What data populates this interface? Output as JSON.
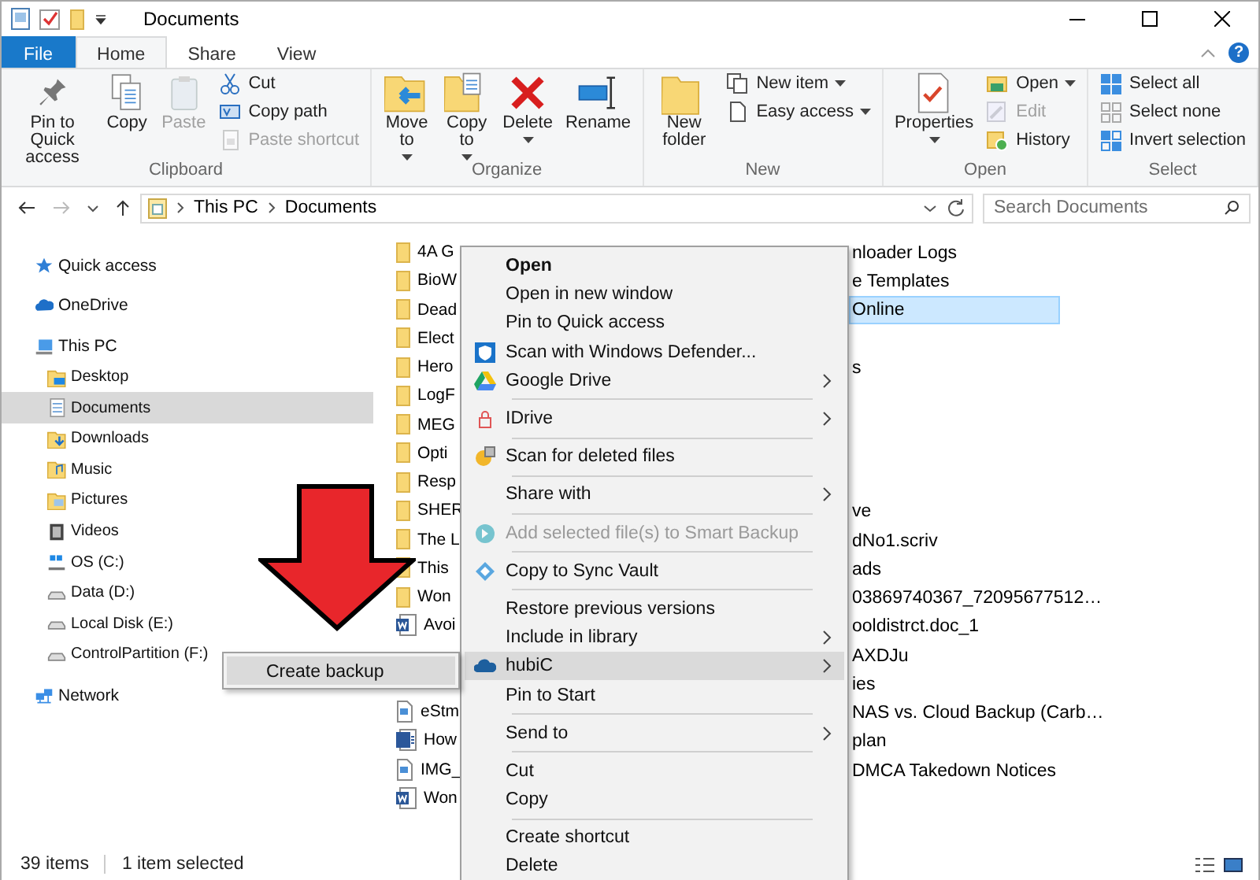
{
  "window": {
    "title": "Documents"
  },
  "ribbon_tabs": [
    {
      "label": "File",
      "kind": "file",
      "selected": false
    },
    {
      "label": "Home",
      "kind": "tab",
      "selected": true
    },
    {
      "label": "Share",
      "kind": "tab",
      "selected": false
    },
    {
      "label": "View",
      "kind": "tab",
      "selected": false
    }
  ],
  "help": {
    "label": "?"
  },
  "ribbon": {
    "groups": [
      {
        "label": "Clipboard",
        "buttons": [
          {
            "label": "Pin to Quick access",
            "kind": "large",
            "disabled": false,
            "dropdown": false
          },
          {
            "label": "Copy",
            "kind": "large",
            "disabled": false,
            "dropdown": false
          },
          {
            "label": "Paste",
            "kind": "large",
            "disabled": true,
            "dropdown": false
          },
          {
            "label": "Cut",
            "kind": "small",
            "disabled": false,
            "dropdown": false
          },
          {
            "label": "Copy path",
            "kind": "small",
            "disabled": false,
            "dropdown": false
          },
          {
            "label": "Paste shortcut",
            "kind": "small",
            "disabled": true,
            "dropdown": false
          }
        ]
      },
      {
        "label": "Organize",
        "buttons": [
          {
            "label": "Move to",
            "kind": "large",
            "disabled": false,
            "dropdown": true
          },
          {
            "label": "Copy to",
            "kind": "large",
            "disabled": false,
            "dropdown": true
          },
          {
            "label": "Delete",
            "kind": "large",
            "disabled": false,
            "dropdown": true
          },
          {
            "label": "Rename",
            "kind": "large",
            "disabled": false,
            "dropdown": false
          }
        ]
      },
      {
        "label": "New",
        "buttons": [
          {
            "label": "New folder",
            "kind": "large",
            "disabled": false,
            "dropdown": false
          },
          {
            "label": "New item",
            "kind": "small",
            "disabled": false,
            "dropdown": true
          },
          {
            "label": "Easy access",
            "kind": "small",
            "disabled": false,
            "dropdown": true
          }
        ]
      },
      {
        "label": "Open",
        "buttons": [
          {
            "label": "Properties",
            "kind": "large",
            "disabled": false,
            "dropdown": true
          },
          {
            "label": "Open",
            "kind": "small",
            "disabled": false,
            "dropdown": true
          },
          {
            "label": "Edit",
            "kind": "small",
            "disabled": true,
            "dropdown": false
          },
          {
            "label": "History",
            "kind": "small",
            "disabled": false,
            "dropdown": false
          }
        ]
      },
      {
        "label": "Select",
        "buttons": [
          {
            "label": "Select all",
            "kind": "small",
            "disabled": false,
            "dropdown": false
          },
          {
            "label": "Select none",
            "kind": "small",
            "disabled": false,
            "dropdown": false
          },
          {
            "label": "Invert selection",
            "kind": "small",
            "disabled": false,
            "dropdown": false
          }
        ]
      }
    ]
  },
  "address_bar": {
    "path": [
      "This PC",
      "Documents"
    ]
  },
  "search": {
    "placeholder": "Search Documents"
  },
  "navigation": {
    "items": [
      {
        "label": "Quick access",
        "selected": false
      },
      {
        "label": "OneDrive",
        "selected": false
      },
      {
        "label": "This PC",
        "selected": false,
        "children": [
          {
            "label": "Desktop",
            "selected": false
          },
          {
            "label": "Documents",
            "selected": true
          },
          {
            "label": "Downloads",
            "selected": false
          },
          {
            "label": "Music",
            "selected": false
          },
          {
            "label": "Pictures",
            "selected": false
          },
          {
            "label": "Videos",
            "selected": false
          },
          {
            "label": "OS (C:)",
            "selected": false
          },
          {
            "label": "Data (D:)",
            "selected": false
          },
          {
            "label": "Local Disk (E:)",
            "selected": false
          },
          {
            "label": "ControlPartition (F:)",
            "selected": false
          }
        ]
      },
      {
        "label": "Network",
        "selected": false
      }
    ]
  },
  "files": [
    {
      "column_1": {
        "name": "4A G",
        "kind": "folder",
        "selected": false
      },
      "column_2": {
        "name": "nloader Logs",
        "selected": false
      }
    },
    {
      "column_1": {
        "name": "BioW",
        "kind": "folder",
        "selected": false
      },
      "column_2": {
        "name": "e Templates",
        "selected": false
      }
    },
    {
      "column_1": {
        "name": "Dead",
        "kind": "folder",
        "selected": false
      },
      "column_2": {
        "name": "Online",
        "selected": true
      }
    },
    {
      "column_1": {
        "name": "Elect",
        "kind": "folder",
        "selected": false
      }
    },
    {
      "column_1": {
        "name": "Hero",
        "kind": "folder",
        "selected": false
      },
      "column_2": {
        "name": "s",
        "selected": false
      }
    },
    {
      "column_1": {
        "name": "LogF",
        "kind": "folder",
        "selected": false
      }
    },
    {
      "column_1": {
        "name": "MEG",
        "kind": "folder",
        "selected": false
      }
    },
    {
      "column_1": {
        "name": "Opti",
        "kind": "folder",
        "selected": false
      }
    },
    {
      "column_1": {
        "name": "Resp",
        "kind": "folder",
        "selected": false
      }
    },
    {
      "column_1": {
        "name": "SHER",
        "kind": "folder",
        "selected": false
      },
      "column_2": {
        "name": "ve",
        "selected": false
      }
    },
    {
      "column_1": {
        "name": "The L",
        "kind": "folder",
        "selected": false
      },
      "column_2": {
        "name": "dNo1.scriv",
        "selected": false
      }
    },
    {
      "column_1": {
        "name": "This",
        "kind": "folder",
        "selected": false
      },
      "column_2": {
        "name": "ads",
        "selected": false
      }
    },
    {
      "column_1": {
        "name": "Won",
        "kind": "folder",
        "selected": false
      },
      "column_2": {
        "name": "03869740367_72095677512…",
        "selected": false
      }
    },
    {
      "column_1": {
        "name": "Avoi",
        "kind": "word",
        "selected": false
      },
      "column_2": {
        "name": "ooldistrct.doc_1",
        "selected": false
      }
    },
    {
      "column_2": {
        "name": "AXDJu",
        "selected": false
      }
    },
    {
      "column_2": {
        "name": "ies",
        "selected": false
      }
    },
    {
      "column_1": {
        "name": "eStm",
        "kind": "file",
        "selected": false
      },
      "column_2": {
        "name": "NAS vs. Cloud Backup (Carb…",
        "selected": false
      }
    },
    {
      "column_1": {
        "name": "How",
        "kind": "word_blue",
        "selected": false
      },
      "column_2": {
        "name": "plan",
        "selected": false
      }
    },
    {
      "column_1": {
        "name": "IMG_",
        "kind": "file",
        "selected": false
      },
      "column_2": {
        "name": "DMCA Takedown Notices",
        "selected": false
      }
    },
    {
      "column_1": {
        "name": "Won",
        "kind": "word",
        "selected": false
      }
    }
  ],
  "context_menu": {
    "items": [
      {
        "kind": "default",
        "label": "Open",
        "submenu": false,
        "disabled": false,
        "selected": false
      },
      {
        "kind": "command",
        "label": "Open in new window",
        "submenu": false,
        "disabled": false,
        "selected": false
      },
      {
        "kind": "command",
        "label": "Pin to Quick access",
        "submenu": false,
        "disabled": false,
        "selected": false
      },
      {
        "kind": "command",
        "label": "Scan with Windows Defender...",
        "submenu": false,
        "disabled": false,
        "selected": false
      },
      {
        "kind": "command",
        "label": "Google Drive",
        "submenu": true,
        "disabled": false,
        "selected": false
      },
      {
        "kind": "separator"
      },
      {
        "kind": "command",
        "label": "IDrive",
        "submenu": true,
        "disabled": false,
        "selected": false
      },
      {
        "kind": "separator"
      },
      {
        "kind": "command",
        "label": "Scan for deleted files",
        "submenu": false,
        "disabled": false,
        "selected": false
      },
      {
        "kind": "separator"
      },
      {
        "kind": "command",
        "label": "Share with",
        "submenu": true,
        "disabled": false,
        "selected": false
      },
      {
        "kind": "separator"
      },
      {
        "kind": "command",
        "label": "Add selected file(s) to Smart Backup",
        "submenu": false,
        "disabled": true,
        "selected": false
      },
      {
        "kind": "separator"
      },
      {
        "kind": "command",
        "label": "Copy to Sync Vault",
        "submenu": false,
        "disabled": false,
        "selected": false
      },
      {
        "kind": "separator"
      },
      {
        "kind": "command",
        "label": "Restore previous versions",
        "submenu": false,
        "disabled": false,
        "selected": false
      },
      {
        "kind": "command",
        "label": "Include in library",
        "submenu": true,
        "disabled": false,
        "selected": false
      },
      {
        "kind": "command",
        "label": "hubiC",
        "submenu": true,
        "disabled": false,
        "selected": true
      },
      {
        "kind": "command",
        "label": "Pin to Start",
        "submenu": false,
        "disabled": false,
        "selected": false
      },
      {
        "kind": "separator"
      },
      {
        "kind": "command",
        "label": "Send to",
        "submenu": true,
        "disabled": false,
        "selected": false
      },
      {
        "kind": "separator"
      },
      {
        "kind": "command",
        "label": "Cut",
        "submenu": false,
        "disabled": false,
        "selected": false
      },
      {
        "kind": "command",
        "label": "Copy",
        "submenu": false,
        "disabled": false,
        "selected": false
      },
      {
        "kind": "separator"
      },
      {
        "kind": "command",
        "label": "Create shortcut",
        "submenu": false,
        "disabled": false,
        "selected": false
      },
      {
        "kind": "command",
        "label": "Delete",
        "submenu": false,
        "disabled": false,
        "selected": false
      }
    ]
  },
  "submenu": {
    "items": [
      {
        "label": "Create backup",
        "selected": true
      }
    ]
  },
  "status_bar": {
    "item_count": "39 items",
    "selection": "1 item selected"
  }
}
